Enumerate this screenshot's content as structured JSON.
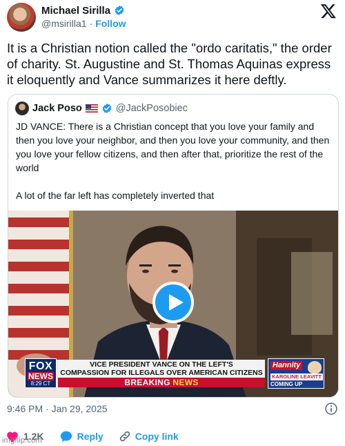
{
  "author": {
    "name": "Michael Sirilla",
    "handle": "@msirilla1",
    "separator": "·",
    "follow_label": "Follow"
  },
  "tweet": {
    "text": "It is a Christian notion called the \"ordo caritatis,\" the order of charity.  St. Augustine and St. Thomas Aquinas express it eloquently and Vance summarizes it here deftly.",
    "timestamp": "9:46 PM · Jan 29, 2025"
  },
  "quote": {
    "name": "Jack Poso",
    "handle": "@JackPosobiec",
    "paragraph_1": "JD VANCE: There is a Christian concept that you love your family and then you love your neighbor, and then you love your community, and then you love your fellow citizens, and then after that, prioritize the rest of the world",
    "paragraph_2": "A lot of the far left has completely inverted that"
  },
  "video": {
    "network_logo": "FOX",
    "network_sub": "NEWS",
    "clock": "8:29 CT",
    "headline_line_1": "VICE PRESIDENT VANCE ON THE LEFT'S",
    "headline_line_2": "COMPASSION FOR ILLEGALS OVER AMERICAN CITIZENS",
    "breaking_1": "BREAKING",
    "breaking_2": "NEWS",
    "promo_show": "Hannity",
    "promo_guest": "KAROLINE LEAVITT",
    "promo_coming": "COMING UP"
  },
  "actions": {
    "likes": "1.2K",
    "reply_label": "Reply",
    "copy_label": "Copy link"
  },
  "watermark": "imgflip.com",
  "colors": {
    "accent": "#1d9bf0",
    "text": "#0f1419",
    "secondary": "#536471",
    "like": "#f91880",
    "fox_red": "#c8102e",
    "fox_blue": "#0c2a6b"
  },
  "icons": [
    "verified-badge-icon",
    "x-logo-icon",
    "us-flag-icon",
    "play-icon",
    "info-icon",
    "heart-icon",
    "reply-bubble-icon",
    "link-icon"
  ]
}
